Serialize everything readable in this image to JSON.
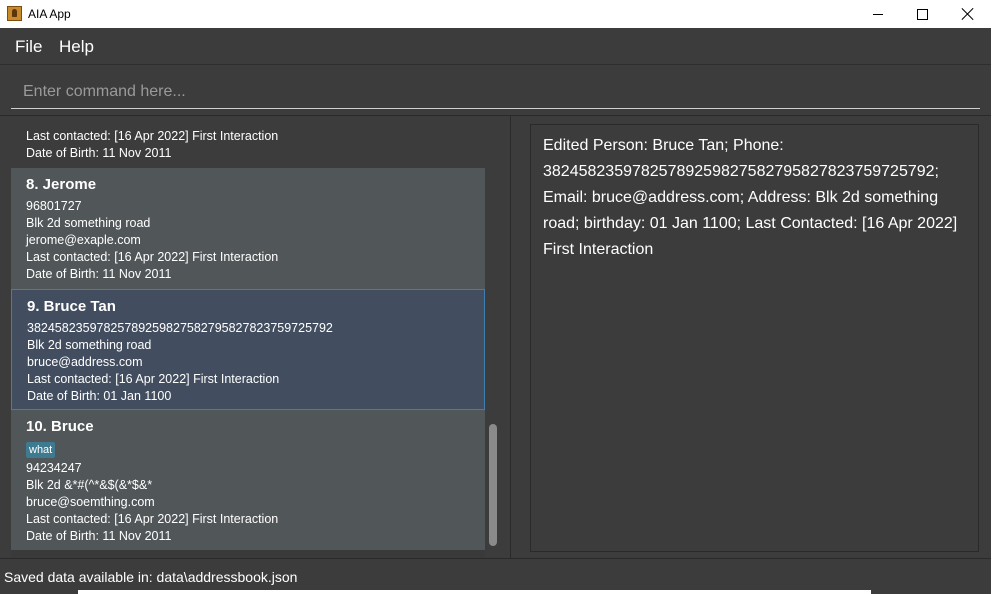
{
  "window": {
    "title": "AIA App"
  },
  "menu": {
    "file": "File",
    "help": "Help"
  },
  "command": {
    "placeholder": "Enter command here...",
    "value": ""
  },
  "persons": [
    {
      "partial": true,
      "last_contacted": "Last contacted: [16 Apr 2022] First Interaction",
      "dob": "Date of Birth: 11 Nov 2011"
    },
    {
      "name": "8.  Jerome",
      "phone": "96801727",
      "address": "Blk 2d something road",
      "email": "jerome@exaple.com",
      "last_contacted": "Last contacted: [16 Apr 2022] First Interaction",
      "dob": "Date of Birth: 11 Nov 2011"
    },
    {
      "name": "9.  Bruce Tan",
      "phone": "38245823597825789259827582795827823759725792",
      "address": "Blk 2d something road",
      "email": "bruce@address.com",
      "last_contacted": "Last contacted: [16 Apr 2022] First Interaction",
      "dob": "Date of Birth: 01 Jan 1100"
    },
    {
      "name": "10.  Bruce",
      "tag": "what",
      "phone": "94234247",
      "address": "Blk 2d &*#(^*&$(&*$&*",
      "email": "bruce@soemthing.com",
      "last_contacted": "Last contacted: [16 Apr 2022] First Interaction",
      "dob": "Date of Birth: 11 Nov 2011"
    }
  ],
  "list_scroll_position": 0.92,
  "result": {
    "text": "Edited Person: Bruce Tan; Phone: 38245823597825789259827582795827823759725792; Email: bruce@address.com; Address: Blk 2d something road; birthday: 01 Jan 1100; Last Contacted: [16 Apr 2022] First Interaction"
  },
  "status": {
    "text": "Saved data available in: data\\addressbook.json"
  },
  "colors": {
    "background": "#3c3c3c",
    "card_odd": "#515658",
    "card_selected": "#424e5f",
    "selected_border": "#3d7fb0",
    "tag": "#3e7b91"
  }
}
